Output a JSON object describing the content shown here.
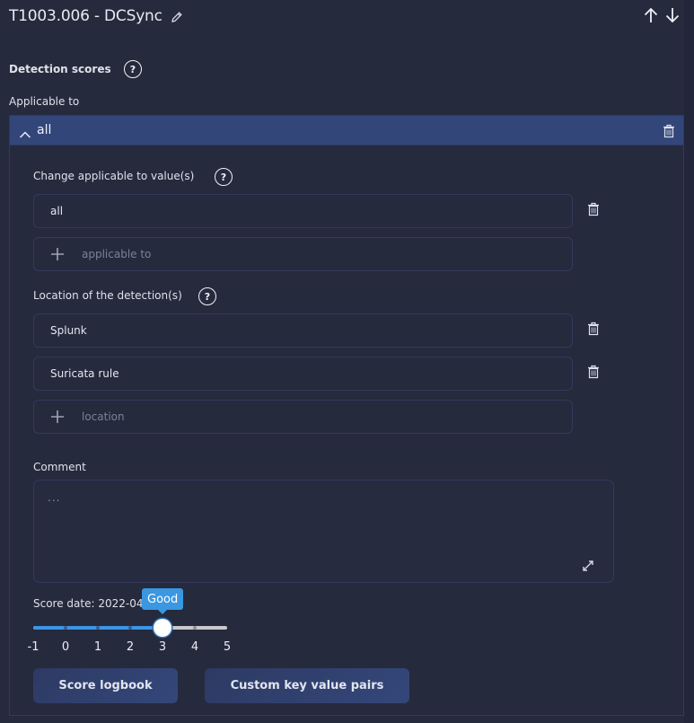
{
  "header": {
    "title": "T1003.006 - DCSync",
    "edit_icon": "pencil-icon",
    "move_up_icon": "arrow-up-icon",
    "move_down_icon": "arrow-down-icon"
  },
  "detection_scores": {
    "label": "Detection scores",
    "help_glyph": "?"
  },
  "applicable_to": {
    "label": "Applicable to",
    "panel": {
      "header_label": "all",
      "expanded": true,
      "change_label": "Change applicable to value(s)",
      "values": [
        "all"
      ],
      "add_placeholder": "applicable to",
      "location_label": "Location of the detection(s)",
      "locations": [
        "Splunk",
        "Suricata rule"
      ],
      "location_placeholder": "location",
      "comment_label": "Comment",
      "comment_placeholder": "...",
      "score_date_label": "Score date: 2022-04",
      "score": {
        "min": -1,
        "max": 5,
        "value": 3,
        "value_label": "Good",
        "ticks": [
          "-1",
          "0",
          "1",
          "2",
          "3",
          "4",
          "5"
        ]
      },
      "buttons": {
        "score_logbook": "Score logbook",
        "custom_kv": "Custom key value pairs"
      }
    }
  },
  "colors": {
    "background": "#262a3d",
    "panel_header": "#33467a",
    "accent_blue": "#3b95e8",
    "button": "#34477a"
  }
}
